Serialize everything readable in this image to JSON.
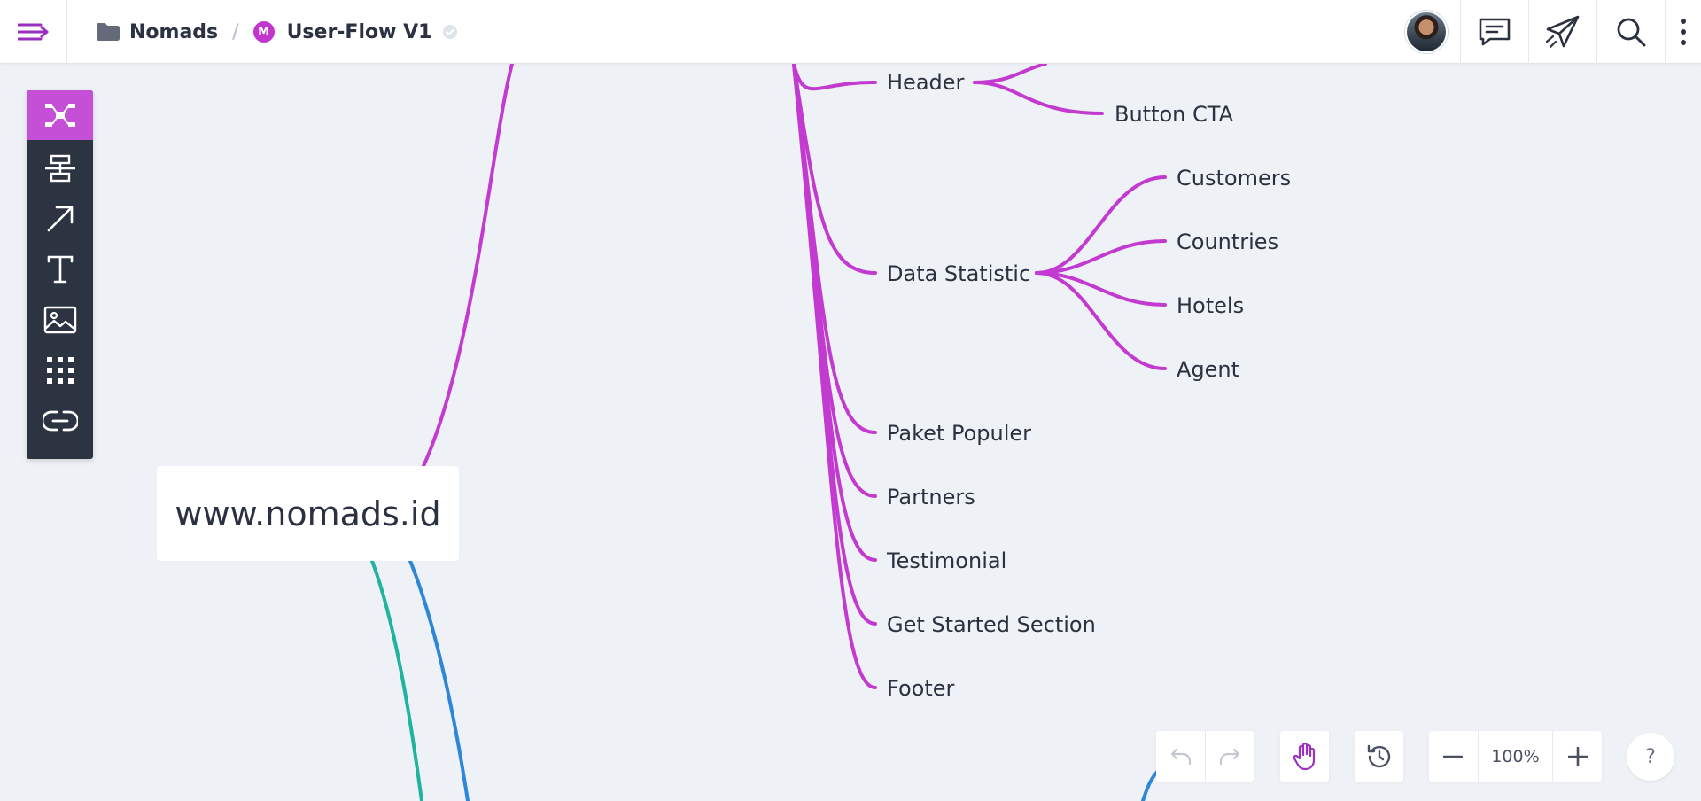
{
  "header": {
    "folder": "Nomads",
    "separator": "/",
    "project_badge": "M",
    "project_title": "User-Flow V1"
  },
  "canvas": {
    "root": "www.nomads.id",
    "nodes": {
      "header": "Header",
      "button_cta": "Button CTA",
      "customers": "Customers",
      "data_statistic": "Data Statistic",
      "countries": "Countries",
      "hotels": "Hotels",
      "agent": "Agent",
      "paket_populer": "Paket Populer",
      "partners": "Partners",
      "testimonial": "Testimonial",
      "get_started": "Get Started Section",
      "footer": "Footer"
    },
    "branch_colors": {
      "purple": "#c23ad0",
      "teal": "#1fb3a0",
      "blue": "#2e86d6"
    }
  },
  "toolbar": {
    "tools": [
      "mindmap-tool",
      "flowchart-tool",
      "arrow-tool",
      "text-tool",
      "image-tool",
      "grid-tool",
      "link-tool"
    ],
    "active_tool": "mindmap-tool"
  },
  "controls": {
    "zoom": "100%",
    "help": "?"
  },
  "colors": {
    "accent": "#c54fd6",
    "toolbar_bg": "#2b3440",
    "canvas_bg": "#eef1f5"
  }
}
